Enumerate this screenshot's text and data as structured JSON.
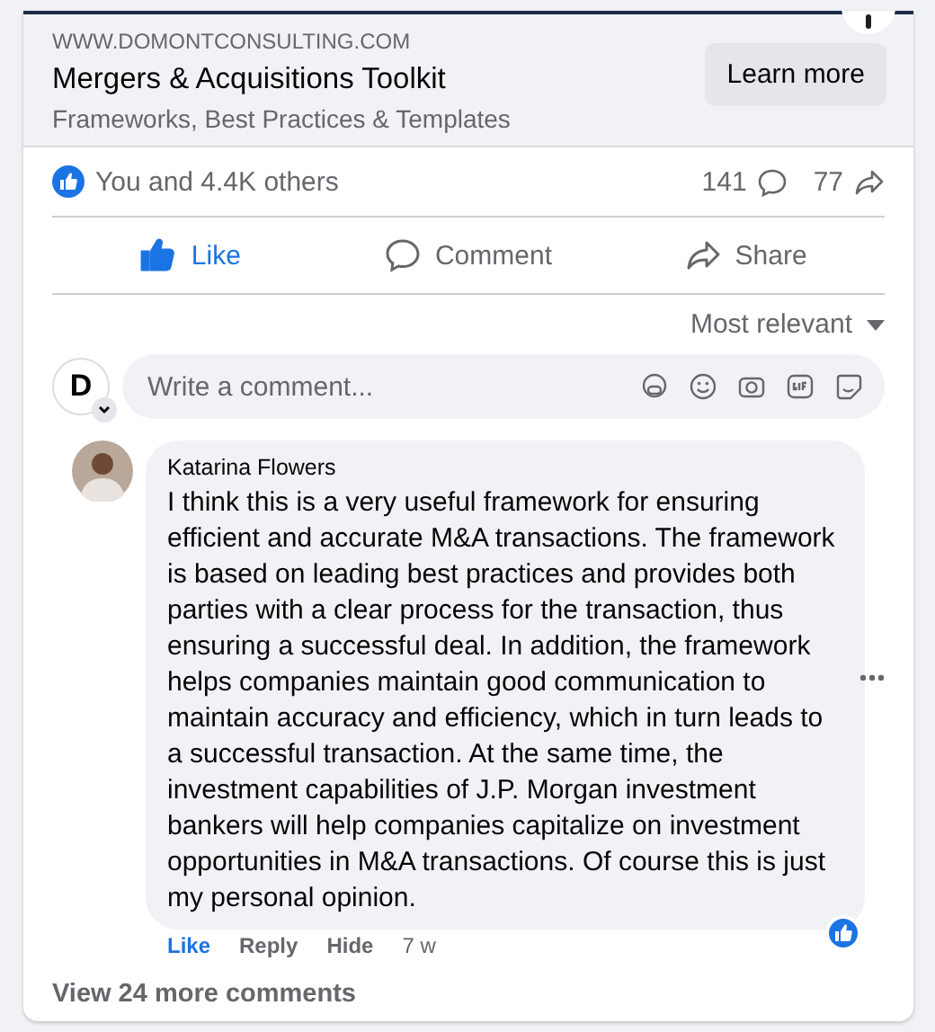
{
  "link_preview": {
    "domain": "WWW.DOMONTCONSULTING.COM",
    "title": "Mergers & Acquisitions Toolkit",
    "subtitle": "Frameworks, Best Practices & Templates",
    "button": "Learn more"
  },
  "reactions": {
    "summary": "You and 4.4K others",
    "comments": "141",
    "shares": "77"
  },
  "actions": [
    {
      "kind": "like",
      "label": "Like",
      "selected": true
    },
    {
      "kind": "comment",
      "label": "Comment",
      "selected": false
    },
    {
      "kind": "share",
      "label": "Share",
      "selected": false
    }
  ],
  "sort": "Most relevant",
  "composer": {
    "avatar_letter": "D",
    "placeholder": "Write a comment..."
  },
  "comment": {
    "author": "Katarina Flowers",
    "text": "I think this is a very useful framework for ensuring efficient and accurate M&A transactions. The framework is based on leading best practices and provides both parties with a clear process for the transaction, thus ensuring a successful deal. In addition, the framework helps companies maintain good communication to maintain accuracy and efficiency, which in turn leads to a successful transaction. At the same time, the investment capabilities of J.P. Morgan investment bankers will help companies capitalize on investment opportunities in M&A transactions. Of course this is just my personal opinion.",
    "liked": true,
    "reply": "Reply",
    "hide": "Hide",
    "like": "Like",
    "time": "7 w"
  },
  "more_comments": "View 24 more comments"
}
